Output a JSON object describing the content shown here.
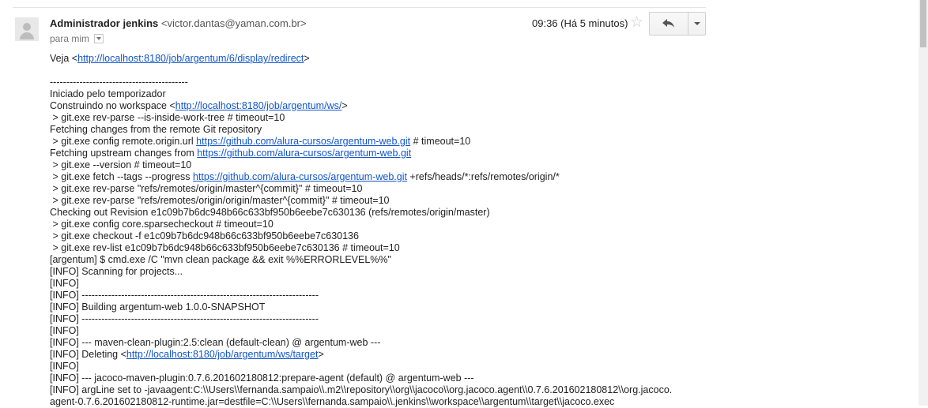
{
  "header": {
    "sender_name": "Administrador jenkins",
    "sender_email": "<victor.dantas@yaman.com.br>",
    "recipient": "para mim",
    "time": "09:36 (Há 5 minutos)",
    "icons": {
      "avatar": "default-avatar-icon",
      "star": "star-icon",
      "reply": "reply-arrow-icon",
      "more": "chevron-down-icon"
    }
  },
  "body": {
    "lines": [
      {
        "pre": "Veja <",
        "link": "http://localhost:8180/job/argentum/6/display/redirect",
        "post": ">"
      },
      {
        "pre": ""
      },
      {
        "pre": "------------------------------------------"
      },
      {
        "pre": "Iniciado pelo temporizador"
      },
      {
        "pre": "Construindo no workspace <",
        "link": "http://localhost:8180/job/argentum/ws/",
        "post": ">"
      },
      {
        "pre": " > git.exe rev-parse --is-inside-work-tree # timeout=10"
      },
      {
        "pre": "Fetching changes from the remote Git repository"
      },
      {
        "pre": " > git.exe config remote.origin.url ",
        "link": "https://github.com/alura-cursos/argentum-web.git",
        "post": " # timeout=10"
      },
      {
        "pre": "Fetching upstream changes from ",
        "link": "https://github.com/alura-cursos/argentum-web.git",
        "post": ""
      },
      {
        "pre": " > git.exe --version # timeout=10"
      },
      {
        "pre": " > git.exe fetch --tags --progress ",
        "link": "https://github.com/alura-cursos/argentum-web.git",
        "post": " +refs/heads/*:refs/remotes/origin/*"
      },
      {
        "pre": " > git.exe rev-parse \"refs/remotes/origin/master^{commit}\" # timeout=10"
      },
      {
        "pre": " > git.exe rev-parse \"refs/remotes/origin/origin/master^{commit}\" # timeout=10"
      },
      {
        "pre": "Checking out Revision e1c09b7b6dc948b66c633bf950b6eebe7c630136 (refs/remotes/origin/master)"
      },
      {
        "pre": " > git.exe config core.sparsecheckout # timeout=10"
      },
      {
        "pre": " > git.exe checkout -f e1c09b7b6dc948b66c633bf950b6eebe7c630136"
      },
      {
        "pre": " > git.exe rev-list e1c09b7b6dc948b66c633bf950b6eebe7c630136 # timeout=10"
      },
      {
        "pre": "[argentum] $ cmd.exe /C \"mvn clean package && exit %%ERRORLEVEL%%\""
      },
      {
        "pre": "[INFO] Scanning for projects..."
      },
      {
        "pre": "[INFO]"
      },
      {
        "pre": "[INFO] ------------------------------------------------------------------------"
      },
      {
        "pre": "[INFO] Building argentum-web 1.0.0-SNAPSHOT"
      },
      {
        "pre": "[INFO] ------------------------------------------------------------------------"
      },
      {
        "pre": "[INFO]"
      },
      {
        "pre": "[INFO] --- maven-clean-plugin:2.5:clean (default-clean) @ argentum-web ---"
      },
      {
        "pre": "[INFO] Deleting <",
        "link": "http://localhost:8180/job/argentum/ws/target",
        "post": ">"
      },
      {
        "pre": "[INFO]"
      },
      {
        "pre": "[INFO] --- jacoco-maven-plugin:0.7.6.201602180812:prepare-agent (default) @ argentum-web ---"
      },
      {
        "pre": "[INFO] argLine set to -javaagent:C:\\\\Users\\\\fernanda.sampaio\\\\.m2\\\\repository\\\\org\\\\jacoco\\\\org.jacoco.agent\\\\0.7.6.201602180812\\\\org.jacoco."
      },
      {
        "pre": "agent-0.7.6.201602180812-runtime.jar=destfile=C:\\\\Users\\\\fernanda.sampaio\\\\.jenkins\\\\workspace\\\\argentum\\\\target\\\\jacoco.exec"
      }
    ]
  }
}
